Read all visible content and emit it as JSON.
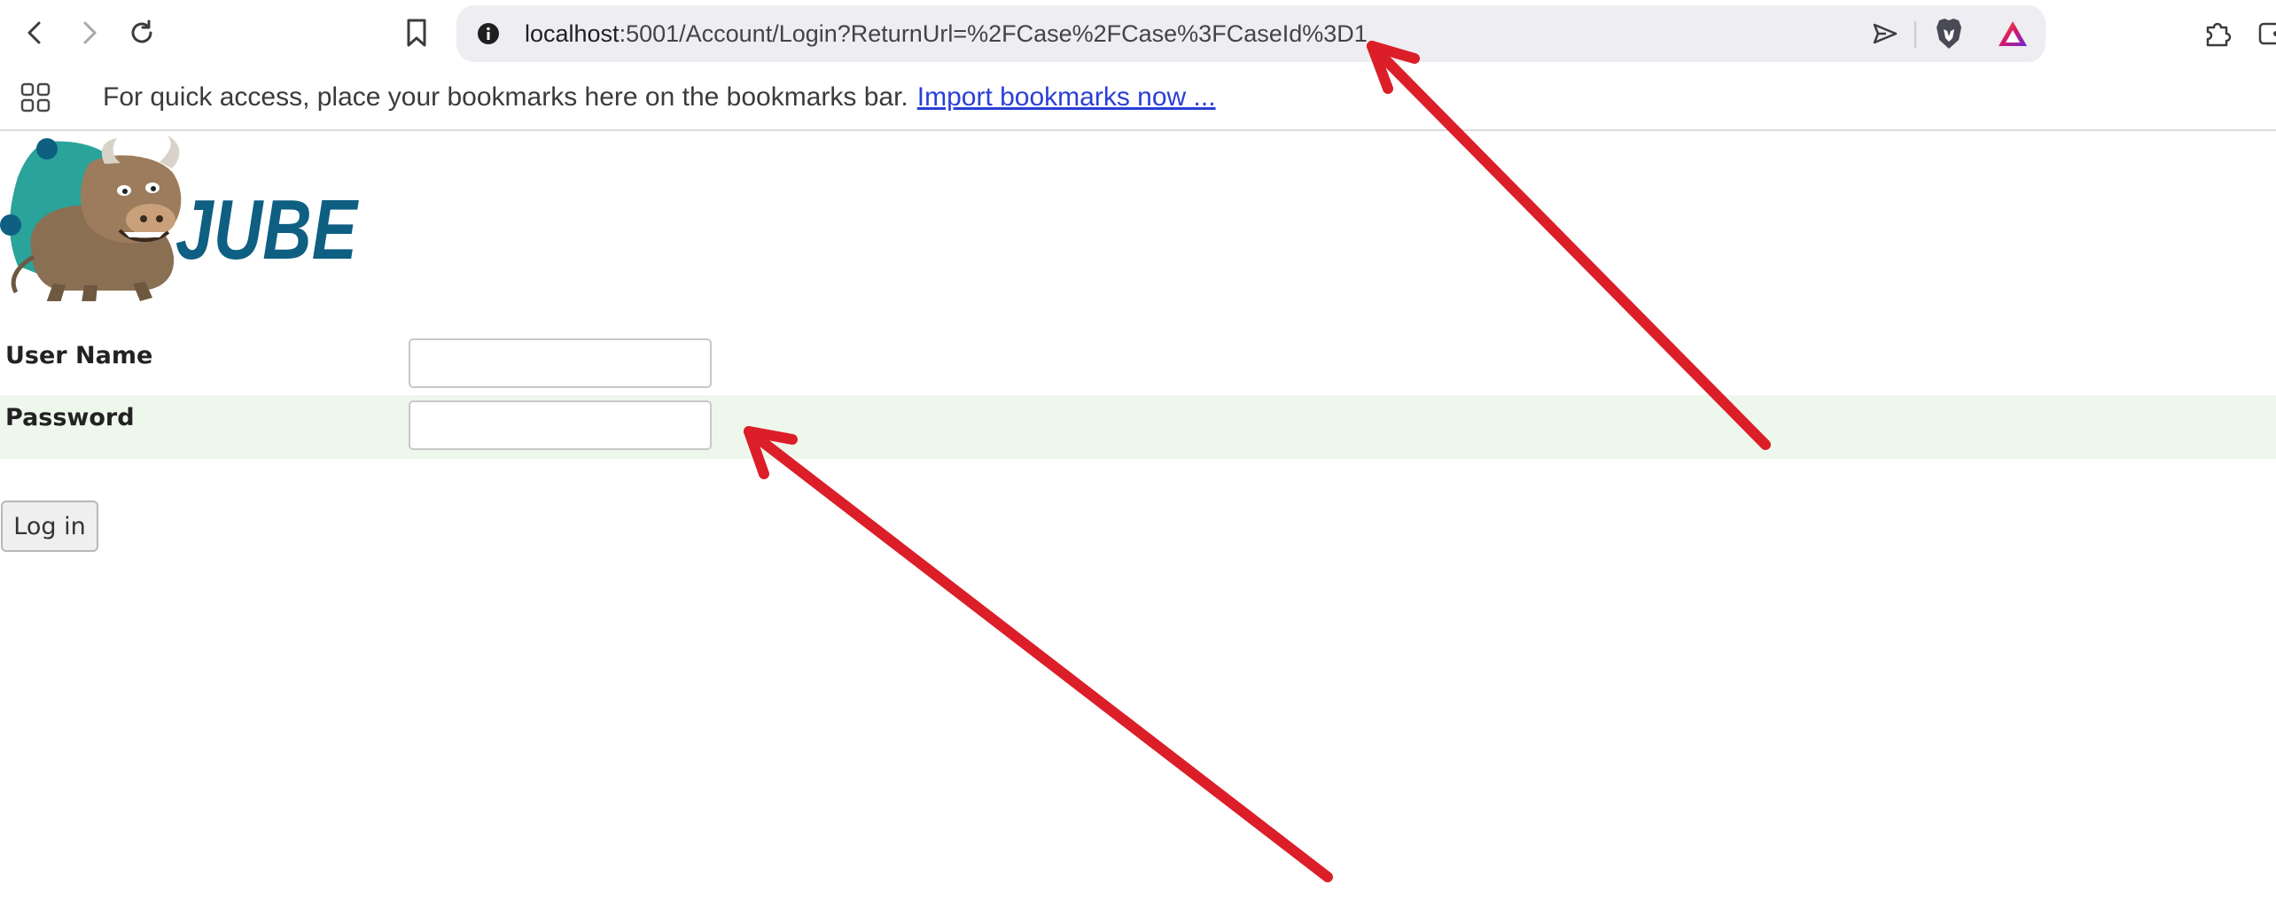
{
  "browser": {
    "url": {
      "host": "localhost",
      "path": ":5001/Account/Login?ReturnUrl=%2FCase%2FCase%3FCaseId%3D1"
    },
    "icons": {
      "back": "back-arrow-icon",
      "forward": "forward-arrow-icon",
      "reload": "reload-icon",
      "bookmark": "bookmark-icon",
      "site_info": "info-icon",
      "send": "send-icon",
      "brave_shields": "brave-lion-icon",
      "brave_rewards": "brave-rewards-triangle-icon",
      "extensions": "puzzle-piece-icon",
      "wallet": "wallet-icon"
    }
  },
  "bookmarks_bar": {
    "message": "For quick access, place your bookmarks here on the bookmarks bar.",
    "import_link": "Import bookmarks now ..."
  },
  "page": {
    "logo": {
      "text": "JUBE",
      "mascot": "bull-mascot-icon"
    },
    "form": {
      "username_label": "User Name",
      "username_value": "",
      "password_label": "Password",
      "password_value": "",
      "submit_label": "Log in"
    }
  },
  "colors": {
    "accent_teal": "#2aa39a",
    "logo_text": "#0e5f82",
    "annotation_arrow": "#dc1e28",
    "password_row_bg": "#eef7ec",
    "link": "#2a3fd6"
  }
}
